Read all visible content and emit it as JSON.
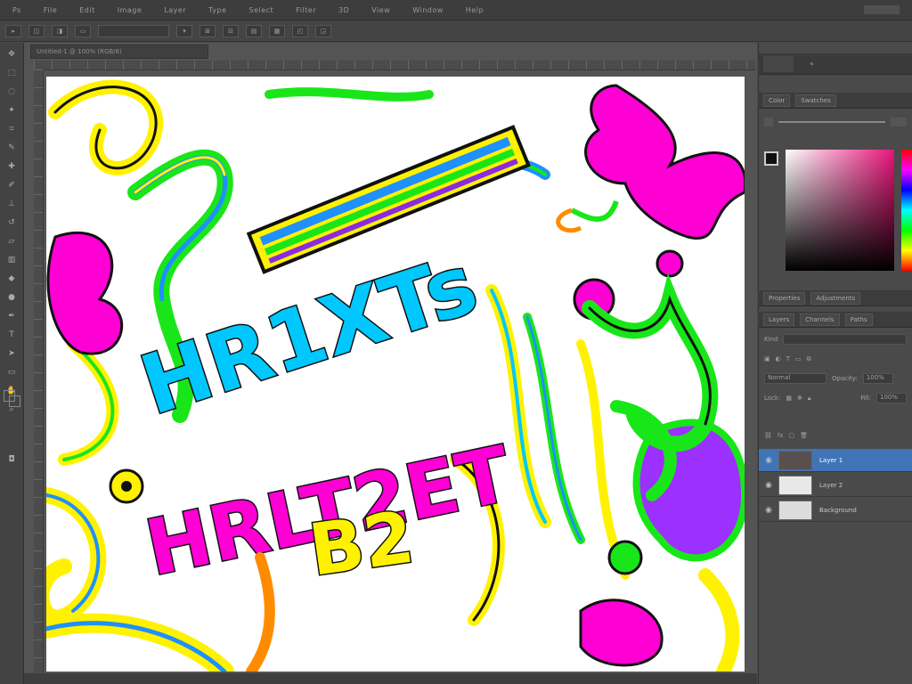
{
  "menubar": {
    "items": [
      {
        "id": "ps-logo",
        "label": "Ps"
      },
      {
        "id": "file",
        "label": "File"
      },
      {
        "id": "edit",
        "label": "Edit"
      },
      {
        "id": "image",
        "label": "Image"
      },
      {
        "id": "layer",
        "label": "Layer"
      },
      {
        "id": "type",
        "label": "Type"
      },
      {
        "id": "select",
        "label": "Select"
      },
      {
        "id": "filter",
        "label": "Filter"
      },
      {
        "id": "3d",
        "label": "3D"
      },
      {
        "id": "view",
        "label": "View"
      },
      {
        "id": "window",
        "label": "Window"
      },
      {
        "id": "help",
        "label": "Help"
      }
    ]
  },
  "document": {
    "tab_label": "Untitled-1 @ 100% (RGB/8)",
    "canvas_words": [
      "HR1XTs",
      "HRLT2ET",
      "B2"
    ]
  },
  "panels": {
    "color_tab": "Color",
    "swatches_tab": "Swatches",
    "properties_tab": "Properties",
    "adjustments_tab": "Adjustments",
    "layers_tab": "Layers",
    "channels_tab": "Channels",
    "paths_tab": "Paths",
    "blend_mode": "Normal",
    "opacity_label": "Opacity:",
    "opacity_value": "100%",
    "fill_label": "Fill:",
    "fill_value": "100%",
    "lock_label": "Lock:",
    "kind_label": "Kind"
  },
  "layers": [
    {
      "name": "Layer 1",
      "active": true
    },
    {
      "name": "Layer 2",
      "active": false
    },
    {
      "name": "Background",
      "active": false
    }
  ],
  "colors": {
    "foreground": "#1a1a1a",
    "background": "#ffffff",
    "accent": "#3f74b6",
    "picker_hue": "#e8157a"
  },
  "icons": [
    "move-icon",
    "marquee-icon",
    "lasso-icon",
    "magic-wand-icon",
    "crop-icon",
    "eyedropper-icon",
    "healing-icon",
    "brush-icon",
    "stamp-icon",
    "history-brush-icon",
    "eraser-icon",
    "gradient-icon",
    "blur-icon",
    "dodge-icon",
    "pen-icon",
    "type-icon",
    "path-select-icon",
    "shape-icon",
    "hand-icon",
    "zoom-icon"
  ]
}
